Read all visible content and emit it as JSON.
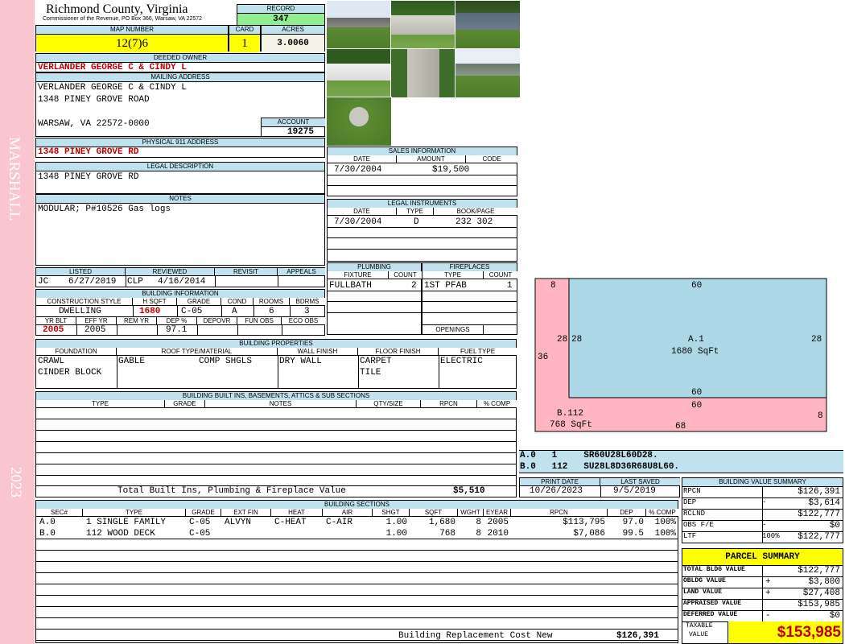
{
  "sidebar": {
    "owner_name": "MARSHALL",
    "year": "2023"
  },
  "header": {
    "county": "Richmond County, Virginia",
    "commissioner": "Commissioner of the Revenue, PO Box 366, Warsaw, VA 22572"
  },
  "record": {
    "label": "RECORD",
    "value": "347"
  },
  "map_number": {
    "label": "MAP NUMBER",
    "value": "12(7)6"
  },
  "card": {
    "label": "CARD",
    "value": "1"
  },
  "acres": {
    "label": "ACRES",
    "value": "3.0060"
  },
  "deeded_owner": {
    "label": "DEEDED OWNER",
    "value": "VERLANDER GEORGE C & CINDY L"
  },
  "mailing_address": {
    "label": "MAILING ADDRESS",
    "line1": "VERLANDER GEORGE C & CINDY L",
    "line2": "1348 PINEY GROVE ROAD",
    "line3": "WARSAW, VA 22572-0000"
  },
  "account": {
    "label": "ACCOUNT",
    "value": "19275"
  },
  "physical_address": {
    "label": "PHYSICAL 911 ADDRESS",
    "value": "1348 PINEY GROVE RD"
  },
  "legal_description": {
    "label": "LEGAL DESCRIPTION",
    "value": "1348 PINEY GROVE RD"
  },
  "notes": {
    "label": "NOTES",
    "value": "MODULAR; P#10526 Gas logs"
  },
  "sales": {
    "label": "SALES INFORMATION",
    "headers": [
      "DATE",
      "AMOUNT",
      "CODE"
    ],
    "rows": [
      [
        "7/30/2004",
        "$19,500",
        ""
      ]
    ]
  },
  "legal_instruments": {
    "label": "LEGAL INSTRUMENTS",
    "headers": [
      "DATE",
      "TYPE",
      "BOOK/PAGE"
    ],
    "rows": [
      [
        "7/30/2004",
        "D",
        "232 302"
      ]
    ]
  },
  "plumbing": {
    "label": "PLUMBING",
    "headers": [
      "FIXTURE",
      "COUNT"
    ],
    "rows": [
      [
        "FULLBATH",
        "2"
      ]
    ]
  },
  "fireplaces": {
    "label": "FIREPLACES",
    "headers": [
      "TYPE",
      "COUNT"
    ],
    "rows": [
      [
        "1ST PFAB",
        "1"
      ]
    ],
    "openings_label": "OPENINGS"
  },
  "listing": {
    "headers": [
      "LISTED",
      "REVIEWED",
      "REVISIT",
      "APPEALS"
    ],
    "listed_by": "JC",
    "listed_date": "6/27/2019",
    "reviewed_by": "CLP",
    "reviewed_date": "4/16/2014"
  },
  "building_info": {
    "label": "BUILDING INFORMATION",
    "headers1": [
      "CONSTRUCTION STYLE",
      "H SQFT",
      "GRADE",
      "COND",
      "ROOMS",
      "BDRMS"
    ],
    "style": "DWELLING",
    "hsqft": "1680",
    "grade": "C-05",
    "cond": "A",
    "rooms": "6",
    "bdrms": "3",
    "headers2": [
      "YR BLT",
      "EFF YR",
      "REM YR",
      "DEP %",
      "DEPOVR",
      "FUN OBS",
      "ECO OBS"
    ],
    "yr_blt": "2005",
    "eff_yr": "2005",
    "dep_pct": "97.1"
  },
  "building_properties": {
    "label": "BUILDING PROPERTIES",
    "headers": [
      "FOUNDATION",
      "ROOF TYPE/MATERIAL",
      "WALL FINISH",
      "FLOOR FINISH",
      "FUEL TYPE"
    ],
    "foundation": [
      "CRAWL",
      "CINDER BLOCK"
    ],
    "roof_type": "GABLE",
    "roof_material": "COMP SHGLS",
    "wall": "DRY WALL",
    "floor": [
      "CARPET",
      "TILE"
    ],
    "fuel": "ELECTRIC"
  },
  "built_ins": {
    "label": "BUILDING BUILT INS, BASEMENTS, ATTICS & SUB SECTIONS",
    "headers": [
      "TYPE",
      "GRADE",
      "NOTES",
      "QTY/SIZE",
      "RPCN",
      "% COMP"
    ],
    "total_label": "Total Built Ins, Plumbing & Fireplace Value",
    "total_value": "$5,510"
  },
  "sketch": {
    "main": {
      "name": "A.1",
      "sqft": "1680 SqFt",
      "top": "60",
      "bottom": "60",
      "left": "28",
      "right": "28"
    },
    "deck": {
      "name": "B.112",
      "sqft": "768 SqFt",
      "top_label": "8",
      "left_label": "36",
      "right_label": "8",
      "bottom_label": "68",
      "inner_top": "60",
      "inner_left": "28"
    },
    "codes": [
      "A.0   1     SR60U28L60D28.",
      "B.0   112   SU28L8D36R68U8L60."
    ]
  },
  "print_info": {
    "headers": [
      "PRINT DATE",
      "LAST SAVED"
    ],
    "print_date": "10/26/2023",
    "last_saved": "9/5/2019"
  },
  "building_value_summary": {
    "label": "BUILDING VALUE SUMMARY",
    "rows": [
      {
        "label": "RPCN",
        "sign": "",
        "value": "$126,391"
      },
      {
        "label": "DEP",
        "sign": "-",
        "value": "$3,614"
      },
      {
        "label": "RCLND",
        "sign": "",
        "value": "$122,777"
      },
      {
        "label": "OBS F/E",
        "sign": "-",
        "value": "$0"
      },
      {
        "label": "LTF",
        "sign": "100%",
        "value": "$122,777"
      }
    ]
  },
  "building_sections": {
    "label": "BUILDING SECTIONS",
    "headers": [
      "SEC#",
      "TYPE",
      "GRADE",
      "EXT FIN",
      "HEAT",
      "AIR",
      "SHGT",
      "SQFT",
      "WGHT",
      "EYEAR",
      "RPCN",
      "DEP",
      "% COMP"
    ],
    "rows": [
      [
        "A.0",
        "1 SINGLE FAMILY",
        "C-05",
        "ALVYN",
        "C-HEAT",
        "C-AIR",
        "1.00",
        "1,680",
        "8",
        "2005",
        "$113,795",
        "97.0",
        "100%"
      ],
      [
        "B.0",
        "112 WOOD DECK",
        "C-05",
        "",
        "",
        "",
        "1.00",
        "768",
        "8",
        "2010",
        "$7,086",
        "99.5",
        "100%"
      ]
    ],
    "footer_label": "Building Replacement Cost New",
    "footer_value": "$126,391"
  },
  "parcel_summary": {
    "label": "PARCEL SUMMARY",
    "rows": [
      {
        "label": "TOTAL BLDG VALUE",
        "sign": "",
        "value": "$122,777"
      },
      {
        "label": "OBLDG VALUE",
        "sign": "+",
        "value": "$3,800"
      },
      {
        "label": "LAND VALUE",
        "sign": "+",
        "value": "$27,408"
      },
      {
        "label": "APPRAISED VALUE",
        "sign": "",
        "value": "$153,985"
      },
      {
        "label": "DEFERRED VALUE",
        "sign": "-",
        "value": "$0"
      }
    ],
    "taxable_label_1": "TAXABLE",
    "taxable_label_2": "VALUE",
    "taxable_value": "$153,985"
  },
  "colors": {
    "sidebar": "#f9c6cf",
    "header_blue": "#bfe2ee",
    "yellow": "#ffff00",
    "green": "#90ee90",
    "red": "#c00000",
    "sketch_blue": "#add8e6",
    "sketch_pink": "#ffb6c1"
  }
}
